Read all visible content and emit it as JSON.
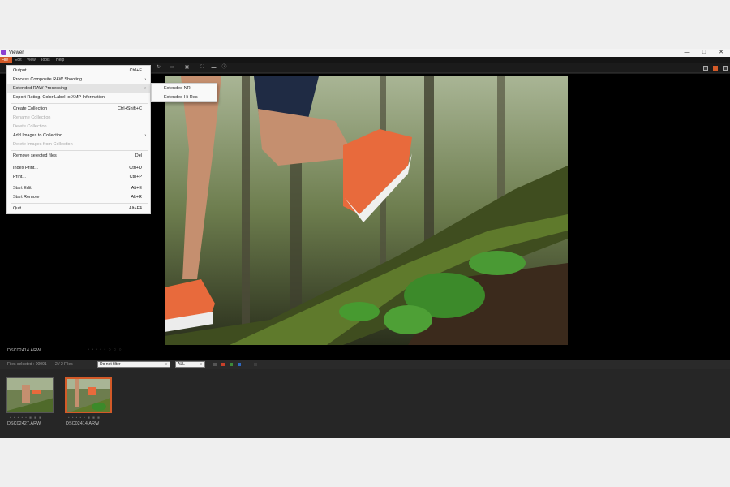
{
  "window": {
    "title": "Viewer",
    "minimize": "—",
    "maximize": "□",
    "close": "✕"
  },
  "menubar": [
    "File",
    "Edit",
    "View",
    "Tools",
    "Help"
  ],
  "file_menu": {
    "output": {
      "label": "Output...",
      "shortcut": "Ctrl+E"
    },
    "process_composite": {
      "label": "Process Composite RAW Shooting",
      "arrow": "›"
    },
    "extended_raw": {
      "label": "Extended RAW Processing",
      "arrow": "›"
    },
    "export_rating": {
      "label": "Export Rating, Color Label to XMP Information"
    },
    "create_collection": {
      "label": "Create Collection",
      "shortcut": "Ctrl+Shift+C"
    },
    "rename_collection": {
      "label": "Rename Collection"
    },
    "delete_collection": {
      "label": "Delete Collection"
    },
    "add_images": {
      "label": "Add Images to Collection",
      "arrow": "›"
    },
    "delete_images": {
      "label": "Delete Images from Collection"
    },
    "remove_selected": {
      "label": "Remove selected files",
      "shortcut": "Del"
    },
    "index_print": {
      "label": "Index Print...",
      "shortcut": "Ctrl+D"
    },
    "print": {
      "label": "Print...",
      "shortcut": "Ctrl+P"
    },
    "start_edit": {
      "label": "Start Edit",
      "shortcut": "Alt+E"
    },
    "start_remote": {
      "label": "Start Remote",
      "shortcut": "Alt+R"
    },
    "quit": {
      "label": "Quit",
      "shortcut": "Alt+F4"
    }
  },
  "submenu": {
    "extended_nr": "Extended NR",
    "extended_hires": "Extended Hi-Res"
  },
  "viewer": {
    "filename": "DSC02414.ARW",
    "rating_dots": "• • • • •  ○ ○ ○"
  },
  "filterbar": {
    "files_selected": "Files selected : 00001",
    "files_count": "2 / 2 Files",
    "filter_value": "Do not filter",
    "all_value": "ALL"
  },
  "thumbnails": [
    {
      "filename": "DSC02427.ARW",
      "meta": "• • • • •  ■ ■ ■"
    },
    {
      "filename": "DSC02414.ARW",
      "meta": "• • • • •  ■ ■ ■"
    }
  ],
  "colors": {
    "accent": "#d35a28",
    "app_logo": "#8a3fd1",
    "background": "#1e1e1e"
  },
  "icons": [
    "rotate-icon",
    "fit-icon",
    "compare-icon",
    "fullscreen-icon",
    "histogram-icon",
    "info-icon",
    "grid-view-icon",
    "single-view-icon",
    "compare-view-icon"
  ]
}
